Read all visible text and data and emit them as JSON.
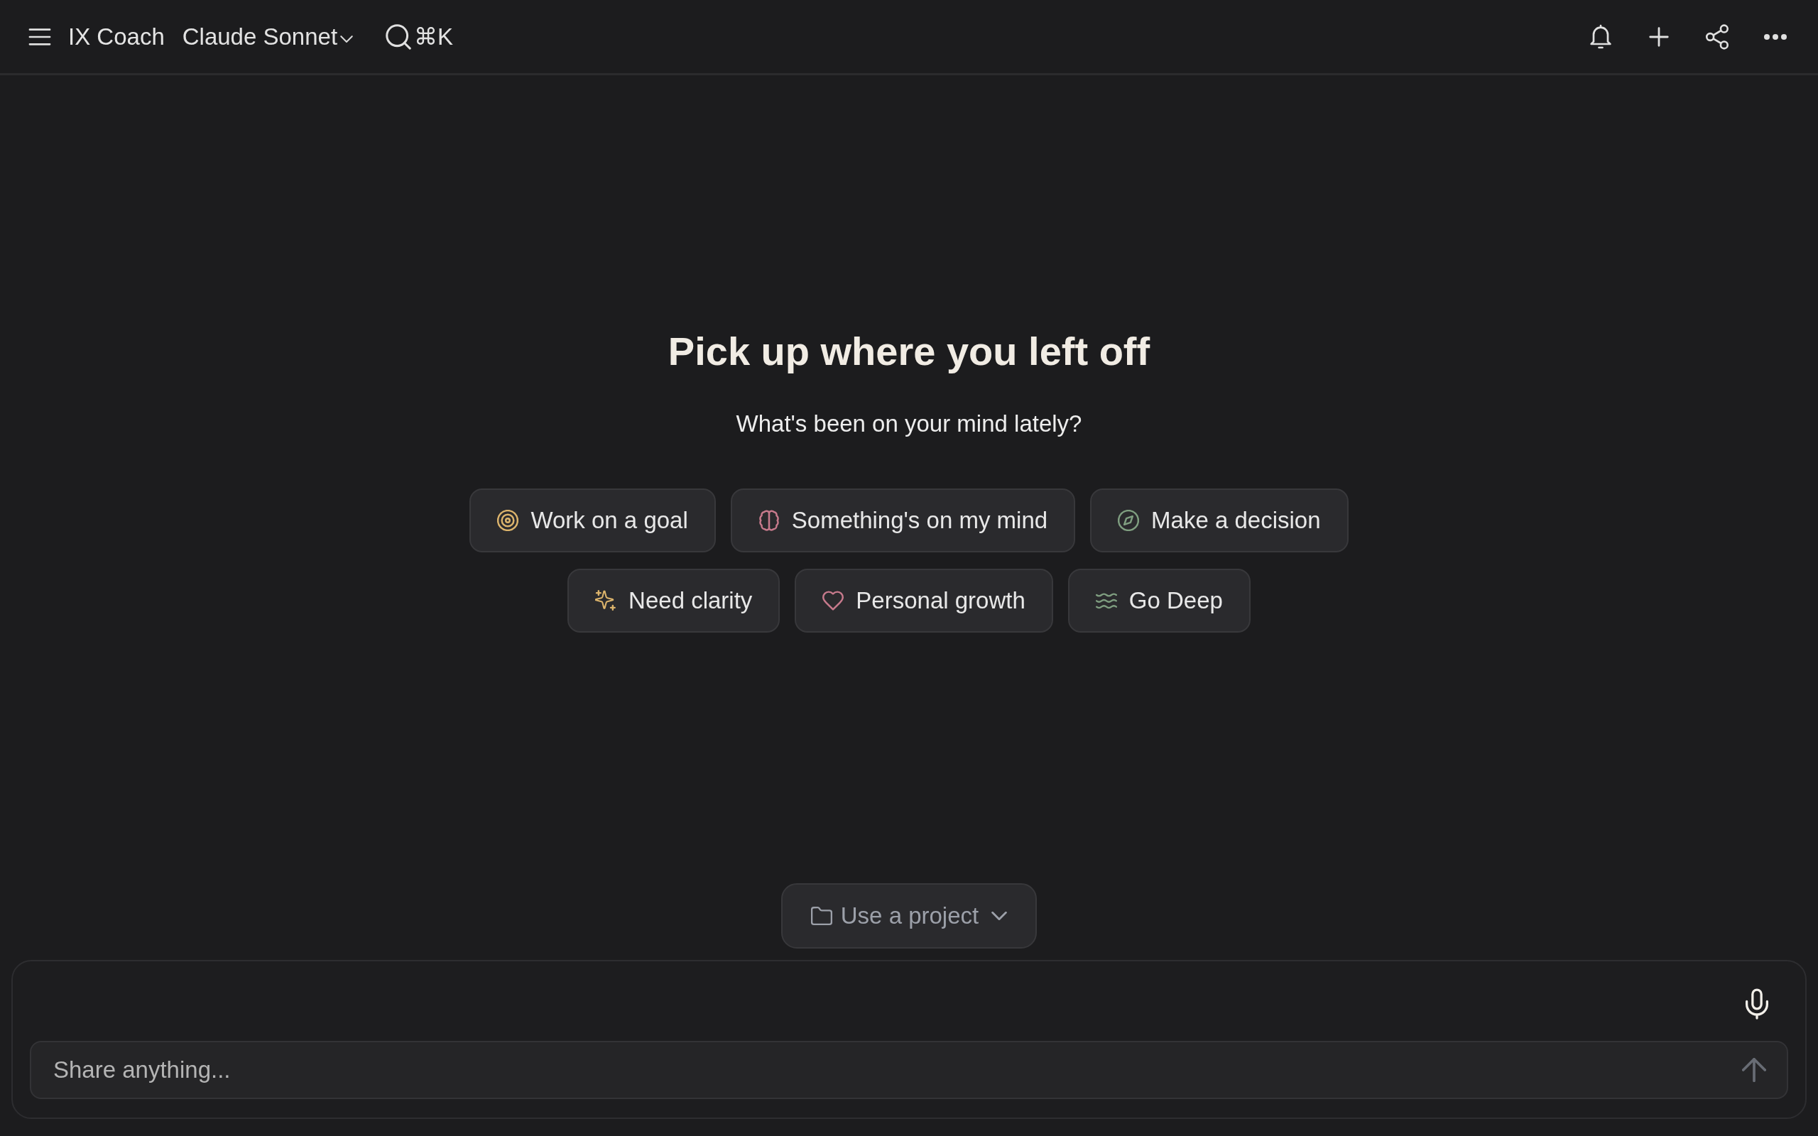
{
  "top_bar": {
    "app_name": "IX Coach",
    "model": "Claude Sonnet",
    "search_shortcut": "⌘K"
  },
  "heading": "Pick up where you left off",
  "subtitle": "What's been on your mind lately?",
  "prompt_chips": [
    {
      "label": "Work on a goal",
      "color": "#dcb46c"
    },
    {
      "label": "Something's on my mind",
      "color": "#c77a8c"
    },
    {
      "label": "Make a decision",
      "color": "#7f9e80"
    },
    {
      "label": "Need clarity",
      "color": "#dcb46c"
    },
    {
      "label": "Personal growth",
      "color": "#c77a8c"
    },
    {
      "label": "Go Deep",
      "color": "#7f9e80"
    }
  ],
  "project_button": {
    "label": "Use a project"
  },
  "composer": {
    "placeholder": "Share anything..."
  },
  "send_button": {
    "disabled": true
  }
}
